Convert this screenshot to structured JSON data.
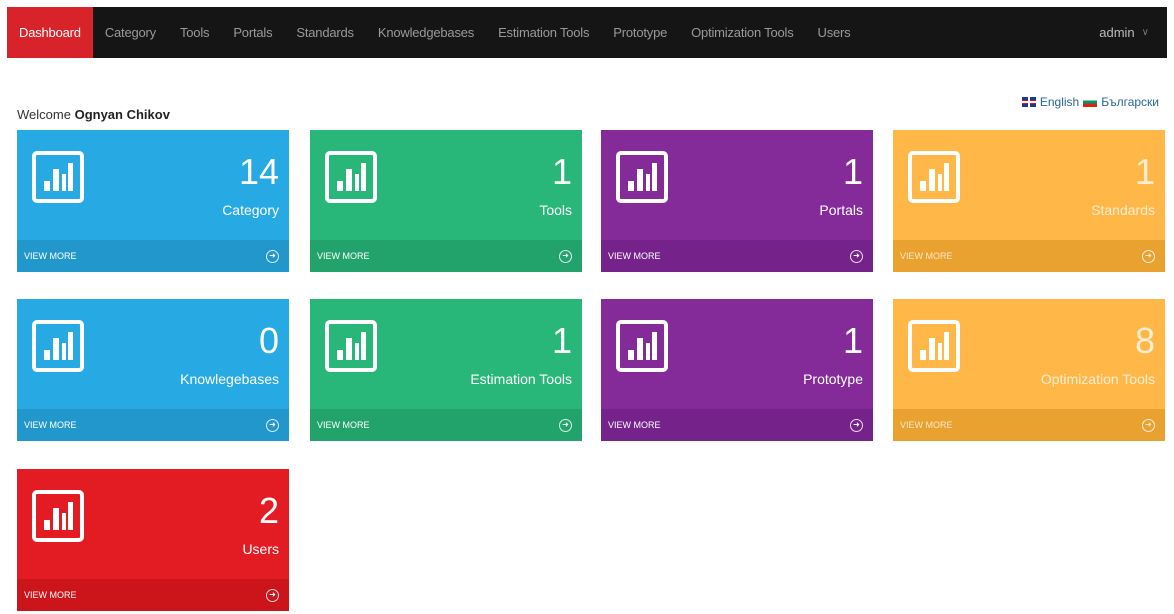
{
  "nav": {
    "items": [
      {
        "label": "Dashboard",
        "active": true
      },
      {
        "label": "Category"
      },
      {
        "label": "Tools"
      },
      {
        "label": "Portals"
      },
      {
        "label": "Standards"
      },
      {
        "label": "Knowledgebases"
      },
      {
        "label": "Estimation Tools"
      },
      {
        "label": "Prototype"
      },
      {
        "label": "Optimization Tools"
      },
      {
        "label": "Users"
      }
    ],
    "user": "admin",
    "user_caret": "∨"
  },
  "welcome": {
    "prefix": "Welcome",
    "name": "Ognyan Chikov"
  },
  "languages": [
    "English",
    "Български"
  ],
  "cards": [
    {
      "count": "14",
      "label": "Category",
      "footer": "VIEW MORE",
      "color": "#27a9e3",
      "icon": "bar-chart-icon"
    },
    {
      "count": "1",
      "label": "Tools",
      "footer": "VIEW MORE",
      "color": "#28b779",
      "icon": "bar-chart-icon"
    },
    {
      "count": "1",
      "label": "Portals",
      "footer": "VIEW MORE",
      "color": "#852b99",
      "icon": "bar-chart-icon"
    },
    {
      "count": "1",
      "label": "Standards",
      "footer": "VIEW MORE",
      "color": "#ffb848",
      "icon": "bar-chart-icon"
    },
    {
      "count": "0",
      "label": "Knowlegebases",
      "footer": "VIEW MORE",
      "color": "#27a9e3",
      "icon": "bar-chart-icon"
    },
    {
      "count": "1",
      "label": "Estimation Tools",
      "footer": "VIEW MORE",
      "color": "#28b779",
      "icon": "bar-chart-icon"
    },
    {
      "count": "1",
      "label": "Prototype",
      "footer": "VIEW MORE",
      "color": "#852b99",
      "icon": "bar-chart-icon"
    },
    {
      "count": "8",
      "label": "Optimization Tools",
      "footer": "VIEW MORE",
      "color": "#ffb848",
      "icon": "bar-chart-icon"
    },
    {
      "count": "2",
      "label": "Users",
      "footer": "VIEW MORE",
      "color": "#e31b23",
      "icon": "bar-chart-icon"
    }
  ]
}
